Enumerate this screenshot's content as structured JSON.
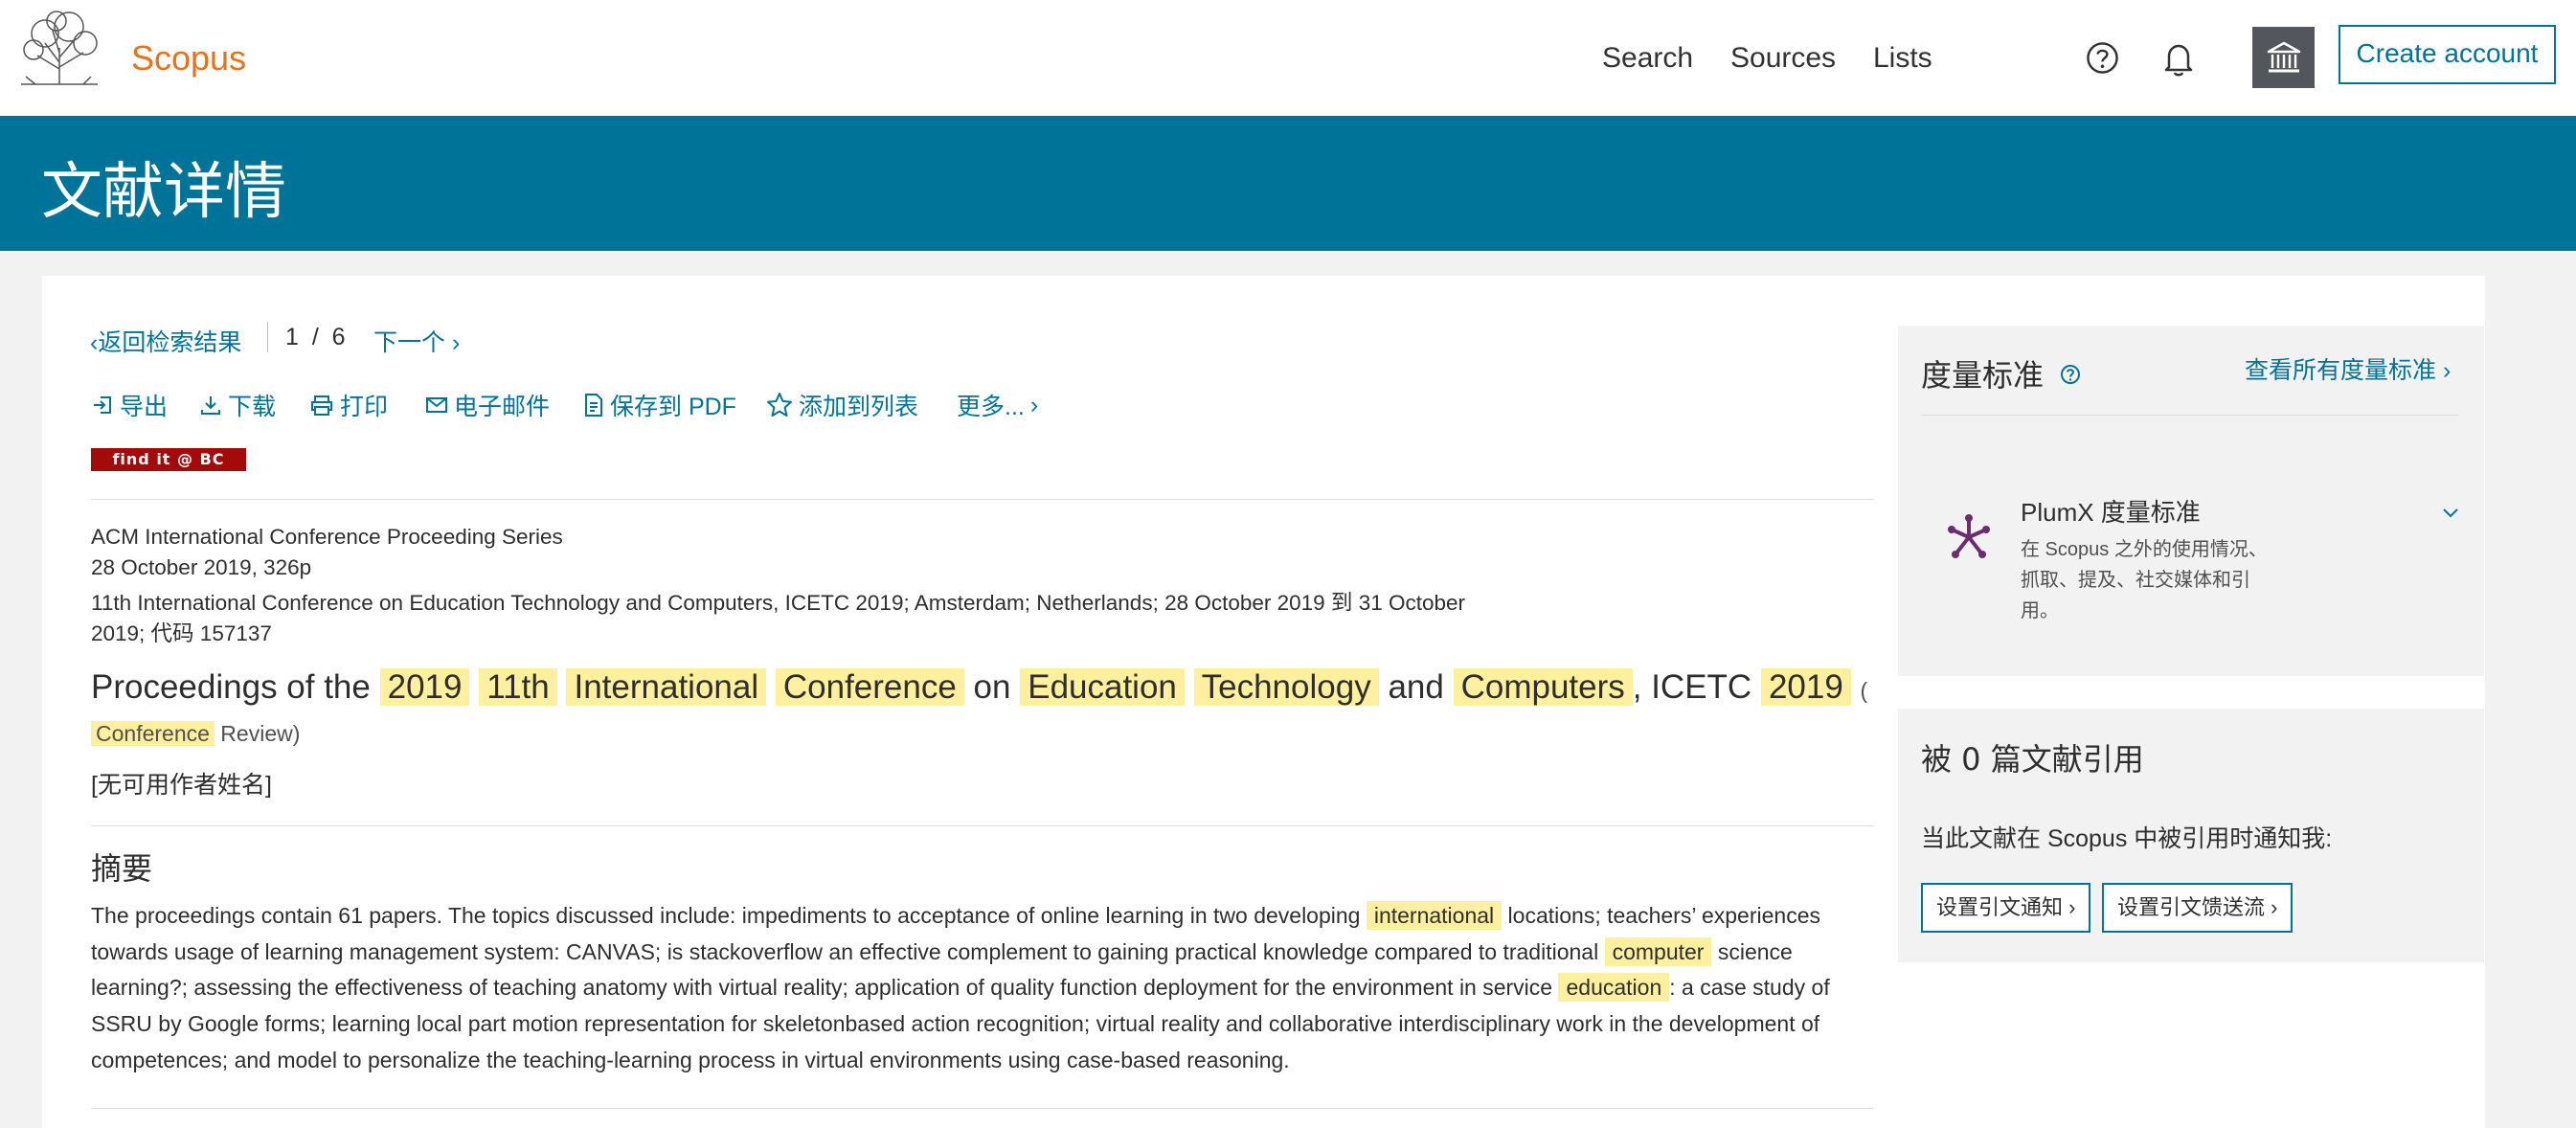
{
  "header": {
    "brand": "Scopus",
    "nav": {
      "search": "Search",
      "sources": "Sources",
      "lists": "Lists"
    },
    "create_account": "Create account",
    "icons": [
      "elsevier-tree-logo",
      "help-icon",
      "bell-icon",
      "institution-icon"
    ]
  },
  "banner": {
    "title": "文献详情"
  },
  "pager": {
    "back": "返回检索结果",
    "position": "1",
    "separator": "/",
    "total": "6",
    "next": "下一个"
  },
  "toolbar": {
    "export": "导出",
    "download": "下载",
    "print": "打印",
    "email": "电子邮件",
    "save_pdf": "保存到 PDF",
    "add_to_list": "添加到列表",
    "more": "更多..."
  },
  "findit": "find it @ BC",
  "meta": {
    "series": "ACM International Conference Proceeding Series",
    "date_pages": "28 October 2019, 326p",
    "conference_line1": "11th International Conference on Education Technology and Computers, ICETC 2019; Amsterdam; Netherlands; 28 October 2019 到 31 October",
    "conference_line2": "2019; 代码 157137"
  },
  "document": {
    "title_parts": [
      {
        "text": "Proceedings of the",
        "hl": false
      },
      {
        "text": "2019",
        "hl": true
      },
      {
        "text": "11th",
        "hl": true
      },
      {
        "text": "International",
        "hl": true
      },
      {
        "text": "Conference",
        "hl": true
      },
      {
        "text": "on",
        "hl": false
      },
      {
        "text": "Education",
        "hl": true
      },
      {
        "text": "Technology",
        "hl": true
      },
      {
        "text": "and",
        "hl": false
      },
      {
        "text": "Computers",
        "hl": true
      },
      {
        "text": ", ICETC",
        "hl": false
      },
      {
        "text": "2019",
        "hl": true
      }
    ],
    "type_open": "(",
    "type_word": "Conference",
    "type_rest": "Review)",
    "authors": "[无可用作者姓名]"
  },
  "abstract": {
    "heading": "摘要",
    "segments": [
      {
        "text": "The proceedings contain 61 papers. The topics discussed include: impediments to acceptance of online learning in two developing ",
        "hl": false
      },
      {
        "text": "international",
        "hl": true
      },
      {
        "text": " locations; teachers’ experiences towards usage of learning management system: CANVAS; is stackoverflow an effective complement to gaining practical knowledge compared to traditional ",
        "hl": false
      },
      {
        "text": "computer",
        "hl": true
      },
      {
        "text": " science learning?; assessing the effectiveness of teaching anatomy with virtual reality; application of quality function deployment for the environment in service ",
        "hl": false
      },
      {
        "text": "education",
        "hl": true
      },
      {
        "text": ": a case study of SSRU by Google forms; learning local part motion representation for skeletonbased action recognition; virtual reality and collaborative interdisciplinary work in the development of competences; and model to personalize the teaching-learning process in virtual environments using case-based reasoning.",
        "hl": false
      }
    ]
  },
  "metrics": {
    "title": "度量标准",
    "view_all": "查看所有度量标准",
    "plumx_title": "PlumX 度量标准",
    "plumx_desc": "在 Scopus 之外的使用情况、抓取、提及、社交媒体和引用。"
  },
  "citations": {
    "title": "被 0 篇文献引用",
    "notify_text": "当此文献在 Scopus 中被引用时通知我:",
    "set_alert": "设置引文通知",
    "set_feed": "设置引文馈送流"
  },
  "colors": {
    "brand_orange": "#e9711c",
    "accent_blue": "#007398",
    "highlight": "#fff0a0"
  }
}
